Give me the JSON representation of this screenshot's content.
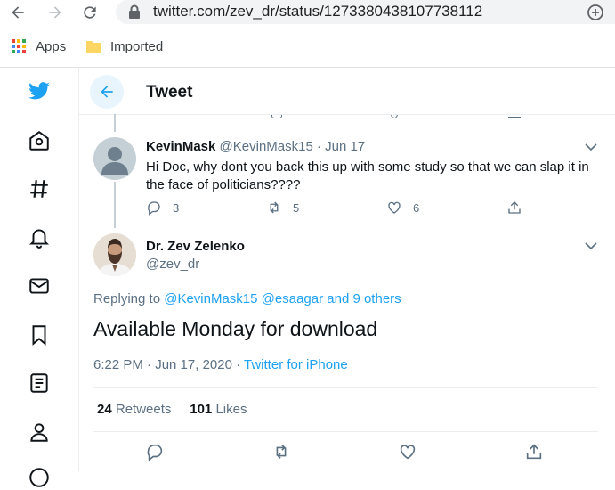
{
  "browser": {
    "url": "twitter.com/zev_dr/status/1273380438107738112",
    "bookmarks": [
      {
        "label": "Apps",
        "icon": "apps-grid-icon"
      },
      {
        "label": "Imported",
        "icon": "folder-icon"
      }
    ]
  },
  "header": {
    "title": "Tweet"
  },
  "reply": {
    "name": "KevinMask",
    "handle": "@KevinMask15",
    "sep": "·",
    "date": "Jun 17",
    "text": "Hi Doc, why dont you back this up with some study so that we can slap it in the face of politicians????",
    "replies": "3",
    "retweets": "5",
    "likes": "6"
  },
  "tweet": {
    "name": "Dr. Zev Zelenko",
    "handle": "@zev_dr",
    "replying_prefix": "Replying to",
    "replying_to": "@KevinMask15 @esaagar and 9 others",
    "text": "Available Monday for download",
    "time": "6:22 PM · Jun 17, 2020 ·",
    "source": "Twitter for iPhone",
    "retweets_count": "24",
    "retweets_label": "Retweets",
    "likes_count": "101",
    "likes_label": "Likes"
  },
  "colors": {
    "accent": "#1da1f2",
    "muted": "#5b7083",
    "text": "#0f1419"
  }
}
